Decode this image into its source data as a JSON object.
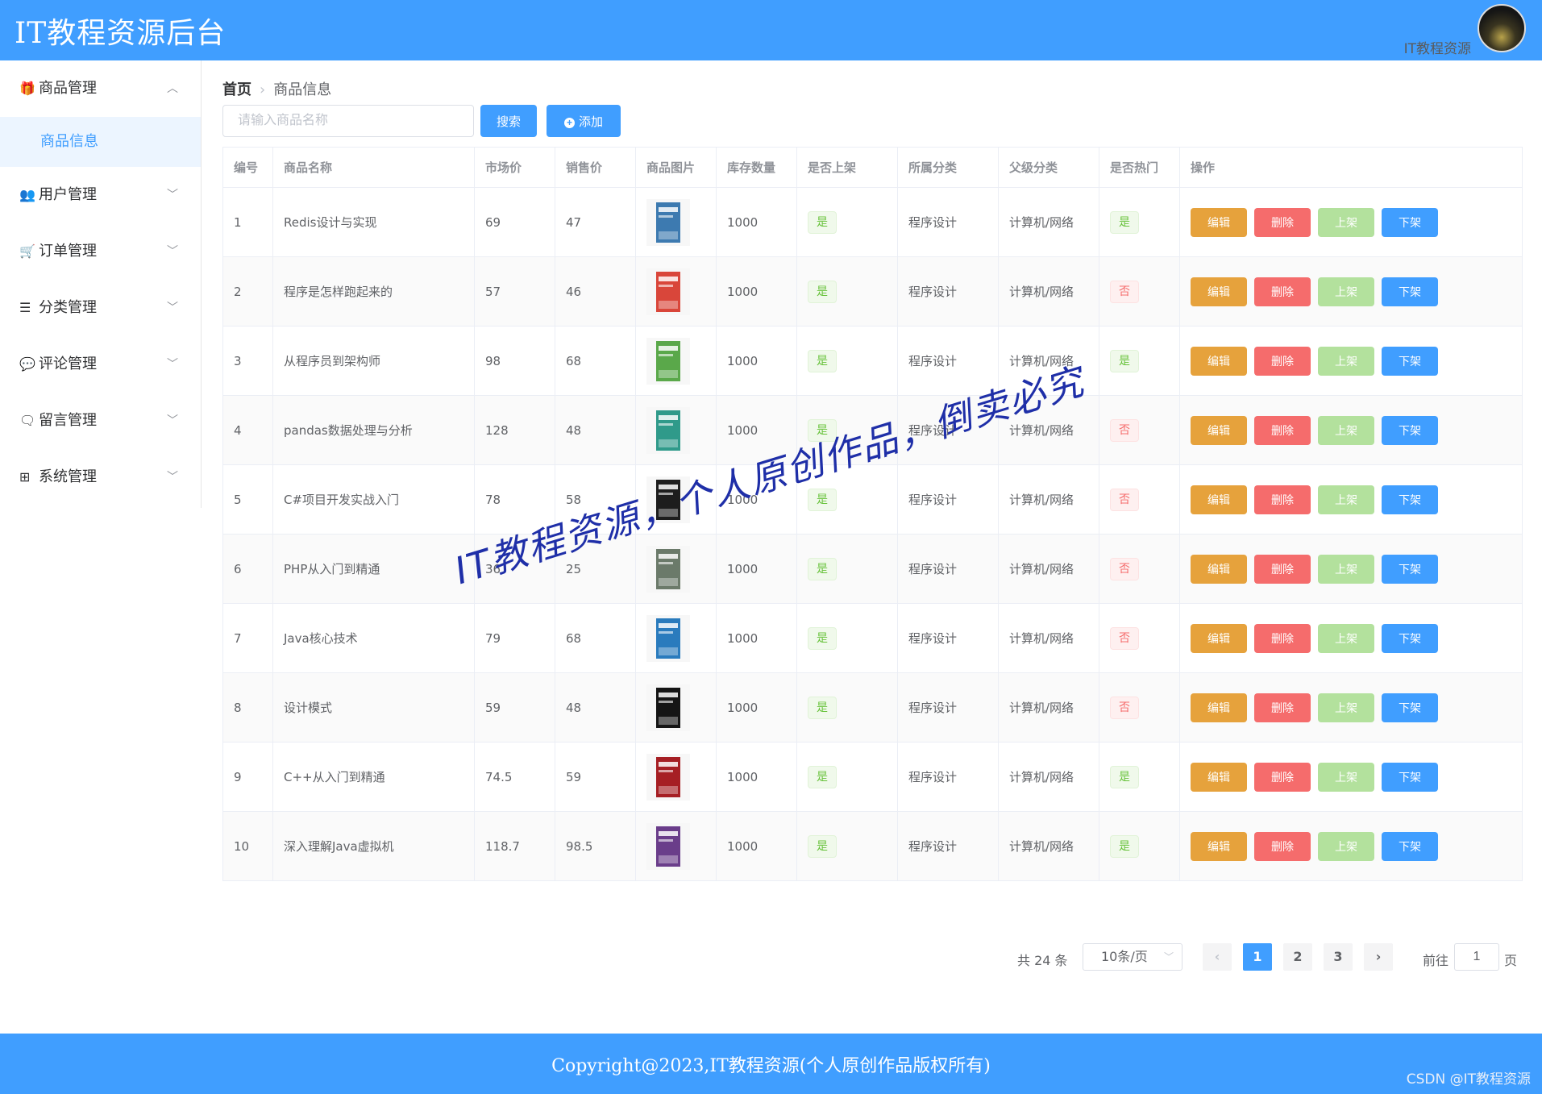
{
  "header": {
    "title": "IT教程资源后台",
    "user_name": "IT教程资源"
  },
  "sidebar": {
    "menus": [
      {
        "label": "商品管理",
        "icon": "gift-icon",
        "glyph": "🎁",
        "chevron": "︿",
        "expanded": true
      },
      {
        "label": "用户管理",
        "icon": "users-icon",
        "glyph": "👥",
        "chevron": "﹀"
      },
      {
        "label": "订单管理",
        "icon": "cart-icon",
        "glyph": "🛒",
        "chevron": "﹀"
      },
      {
        "label": "分类管理",
        "icon": "list-icon",
        "glyph": "☰",
        "chevron": "﹀"
      },
      {
        "label": "评论管理",
        "icon": "comment-icon",
        "glyph": "💬",
        "chevron": "﹀"
      },
      {
        "label": "留言管理",
        "icon": "message-icon",
        "glyph": "🗨",
        "chevron": "﹀"
      },
      {
        "label": "系统管理",
        "icon": "windows-icon",
        "glyph": "⊞",
        "chevron": "﹀"
      }
    ],
    "submenu_active": "商品信息"
  },
  "breadcrumb": {
    "home": "首页",
    "current": "商品信息"
  },
  "toolbar": {
    "search_placeholder": "请输入商品名称",
    "search_label": "搜索",
    "add_label": "添加"
  },
  "table": {
    "columns": [
      "编号",
      "商品名称",
      "市场价",
      "销售价",
      "商品图片",
      "库存数量",
      "是否上架",
      "所属分类",
      "父级分类",
      "是否热门",
      "操作"
    ],
    "actions": {
      "edit": "编辑",
      "delete": "删除",
      "up": "上架",
      "down": "下架"
    },
    "rows": [
      {
        "id": "1",
        "name": "Redis设计与实现",
        "market": "69",
        "sale": "47",
        "stock": "1000",
        "on_sale": "是",
        "category": "程序设计",
        "parent": "计算机/网络",
        "hot": "是",
        "cover": "#3d7ab0"
      },
      {
        "id": "2",
        "name": "程序是怎样跑起来的",
        "market": "57",
        "sale": "46",
        "stock": "1000",
        "on_sale": "是",
        "category": "程序设计",
        "parent": "计算机/网络",
        "hot": "否",
        "cover": "#d9463a"
      },
      {
        "id": "3",
        "name": "从程序员到架构师",
        "market": "98",
        "sale": "68",
        "stock": "1000",
        "on_sale": "是",
        "category": "程序设计",
        "parent": "计算机/网络",
        "hot": "是",
        "cover": "#5aa84a"
      },
      {
        "id": "4",
        "name": "pandas数据处理与分析",
        "market": "128",
        "sale": "48",
        "stock": "1000",
        "on_sale": "是",
        "category": "程序设计",
        "parent": "计算机/网络",
        "hot": "否",
        "cover": "#2f9a8a"
      },
      {
        "id": "5",
        "name": "C#项目开发实战入门",
        "market": "78",
        "sale": "58",
        "stock": "1000",
        "on_sale": "是",
        "category": "程序设计",
        "parent": "计算机/网络",
        "hot": "否",
        "cover": "#1d1d1d"
      },
      {
        "id": "6",
        "name": "PHP从入门到精通",
        "market": "36",
        "sale": "25",
        "stock": "1000",
        "on_sale": "是",
        "category": "程序设计",
        "parent": "计算机/网络",
        "hot": "否",
        "cover": "#6b7a6a"
      },
      {
        "id": "7",
        "name": "Java核心技术",
        "market": "79",
        "sale": "68",
        "stock": "1000",
        "on_sale": "是",
        "category": "程序设计",
        "parent": "计算机/网络",
        "hot": "否",
        "cover": "#2a7bbd"
      },
      {
        "id": "8",
        "name": "设计模式",
        "market": "59",
        "sale": "48",
        "stock": "1000",
        "on_sale": "是",
        "category": "程序设计",
        "parent": "计算机/网络",
        "hot": "否",
        "cover": "#151515"
      },
      {
        "id": "9",
        "name": "C++从入门到精通",
        "market": "74.5",
        "sale": "59",
        "stock": "1000",
        "on_sale": "是",
        "category": "程序设计",
        "parent": "计算机/网络",
        "hot": "是",
        "cover": "#a61f24"
      },
      {
        "id": "10",
        "name": "深入理解Java虚拟机",
        "market": "118.7",
        "sale": "98.5",
        "stock": "1000",
        "on_sale": "是",
        "category": "程序设计",
        "parent": "计算机/网络",
        "hot": "是",
        "cover": "#6a3d8a"
      }
    ]
  },
  "pagination": {
    "total_text": "共 24 条",
    "page_size": "10条/页",
    "pages": [
      "1",
      "2",
      "3"
    ],
    "current_page": "1",
    "prev": "‹",
    "next": "›",
    "goto_label": "前往",
    "goto_value": "1",
    "page_unit": "页"
  },
  "watermark": "IT教程资源，个人原创作品，倒卖必究",
  "footer": {
    "copyright": "Copyright@2023,IT教程资源(个人原创作品版权所有)",
    "csdn": "CSDN @IT教程资源"
  },
  "colors": {
    "primary": "#409EFF",
    "warning": "#e6a23c",
    "danger": "#f56c6c",
    "success_light": "#b3e19d"
  }
}
